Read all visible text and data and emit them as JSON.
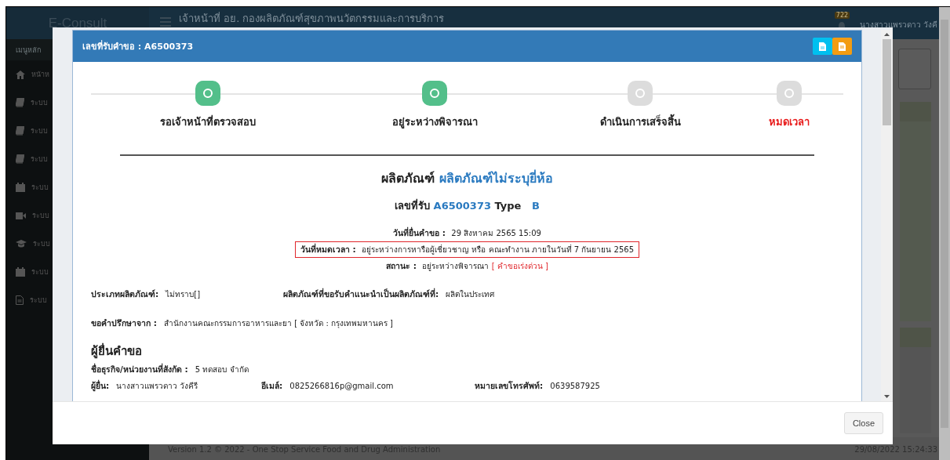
{
  "background": {
    "brand": "E-Consult",
    "header_title": "เจ้าหน้าที่ อย. กองผลิตภัณฑ์สุขภาพนวัตกรรมและการบริการ",
    "notification_count": "722",
    "user_name": "นางสาวแพรวดาว วังคี",
    "menu_heading": "เมนูหลัก",
    "menu_items": [
      {
        "kind": "home",
        "label": "หน้าห"
      },
      {
        "kind": "book",
        "label": "ระบบ"
      },
      {
        "kind": "book",
        "label": "ระบบ"
      },
      {
        "kind": "book",
        "label": "ระบบ"
      },
      {
        "kind": "calendar",
        "label": "ระบบ"
      },
      {
        "kind": "video",
        "label": "ระบบ"
      },
      {
        "kind": "graduation",
        "label": "ระบบ"
      },
      {
        "kind": "calendar",
        "label": "ระบบ"
      },
      {
        "kind": "file",
        "label": "ระบบ"
      }
    ],
    "footer_text": "Version 1.2 © 2022 - One Stop Service Food and Drug Administration",
    "footer_time": "29/08/2022 15:24:33"
  },
  "modal": {
    "title": "เลขที่รับคำขอ : A6500373",
    "header_buttons": [
      {
        "kind": "document",
        "color": "#00c0ef"
      },
      {
        "kind": "pdf",
        "color": "#f39c12"
      }
    ],
    "steps": [
      {
        "label": "รอเจ้าหน้าที่ตรวจสอบ",
        "done": true,
        "alert": false
      },
      {
        "label": "อยู่ระหว่างพิจารณา",
        "done": true,
        "alert": false
      },
      {
        "label": "ดำเนินการเสร็จสิ้น",
        "done": false,
        "alert": false
      },
      {
        "label": "หมดเวลา",
        "done": false,
        "alert": true
      }
    ],
    "product": {
      "label": "ผลิตภัณฑ์",
      "name": "ผลิตภัณฑ์ไม่ระบุยี่ห้อ"
    },
    "receipt": {
      "label": "เลขที่รับ",
      "number": "A6500373",
      "type_label": "Type",
      "type": "B"
    },
    "dates": [
      {
        "label": "วันที่ยื่นคำขอ :",
        "value": "29 สิงหาคม 2565 15:09",
        "highlighted": false
      },
      {
        "label": "วันที่หมดเวลา :",
        "value": "อยู่ระหว่างการหารือผู้เชี่ยวชาญ หรือ คณะทำงาน ภายในวันที่ 7 กันยายน 2565",
        "highlighted": true
      },
      {
        "label": "สถานะ :",
        "value": "อยู่ระหว่างพิจารณา",
        "note": "[ คำขอเร่งด่วน ]",
        "highlighted": false
      }
    ],
    "details": [
      [
        {
          "label": "ประเภทผลิตภัณฑ์:",
          "value": "ไม่ทราบ[]"
        },
        {
          "label": "ผลิตภัณฑ์ที่ขอรับคำแนะนำเป็นผลิตภัณฑ์ที่:",
          "value": "ผลิตในประเทศ"
        }
      ],
      [
        {
          "label": "ขอคำปรึกษาจาก :",
          "value": "สำนักงานคณะกรรมการอาหารและยา [ จังหวัด : กรุงเทพมหานคร ]"
        }
      ]
    ],
    "applicant": {
      "heading": "ผู้ยื่นคำขอ",
      "rows": [
        [
          {
            "label": "ชื่อธุรกิจ/หน่วยงานที่สังกัด :",
            "value": "5 ทดสอบ จำกัด"
          }
        ],
        [
          {
            "label": "ผู้ยื่น:",
            "value": "นางสาวแพรวดาว วังคีรี"
          },
          {
            "label": "อีเมล์:",
            "value": "0825266816p@gmail.com"
          },
          {
            "label": "หมายเลขโทรศัพท์:",
            "value": "0639587925"
          }
        ]
      ]
    },
    "close_button": "Close"
  }
}
